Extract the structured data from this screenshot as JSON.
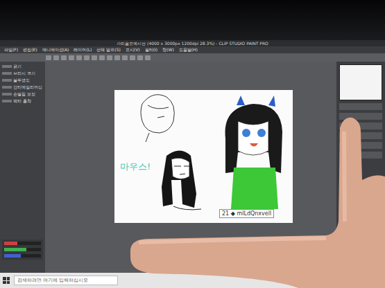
{
  "window": {
    "title": "가리음표예시선 (4000 x 3000px 1200dpi 28.3%) - CLIP STUDIO PAINT PRO"
  },
  "menu": [
    "파일(F)",
    "편집(E)",
    "애니메이션(A)",
    "레이어(L)",
    "선택 범위(S)",
    "표시(V)",
    "필터(I)",
    "창(W)",
    "도움말(H)"
  ],
  "tool_panel": {
    "labels": [
      "굵기",
      "브러시 크기",
      "불투명도",
      "안티에일리어싱",
      "손떨림 보정",
      "벡터 흡착"
    ]
  },
  "color_sliders": [
    {
      "level": 0.35,
      "color": "#d04040"
    },
    {
      "level": 0.6,
      "color": "#40b050"
    },
    {
      "level": 0.45,
      "color": "#4060d0"
    }
  ],
  "canvas": {
    "text": "마우스!",
    "selection_label": "21 ◆ mlLdQnxvell"
  },
  "taskbar": {
    "search_placeholder": "검색하려면 여기에 입력하십시오"
  }
}
